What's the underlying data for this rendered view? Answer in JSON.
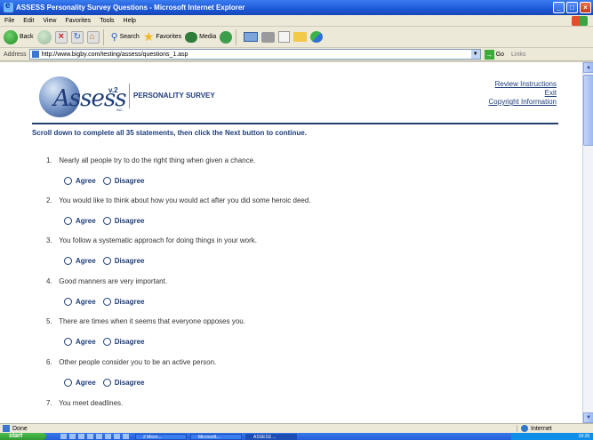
{
  "window": {
    "title": "ASSESS Personality Survey Questions - Microsoft Internet Explorer"
  },
  "menu": [
    "File",
    "Edit",
    "View",
    "Favorites",
    "Tools",
    "Help"
  ],
  "toolbar": {
    "back": "Back",
    "search": "Search",
    "favorites": "Favorites",
    "media": "Media"
  },
  "address": {
    "label": "Address",
    "url": "http://www.bigby.com/testing/assess/questions_1.asp",
    "go": "Go",
    "links": "Links"
  },
  "page": {
    "logo_word": "Assess",
    "logo_version": "v.2",
    "logo_inc": "INC.",
    "survey_title": "PERSONALITY SURVEY",
    "links": [
      "Review Instructions",
      "Exit",
      "Copyright Information"
    ],
    "intro": "Scroll down to complete all 35 statements, then click the Next button to continue.",
    "answer_agree": "Agree",
    "answer_disagree": "Disagree",
    "questions": [
      {
        "num": "1.",
        "text": "Nearly all people try to do the right thing when given a chance."
      },
      {
        "num": "2.",
        "text": "You would like to think about how you would act after you did some heroic deed."
      },
      {
        "num": "3.",
        "text": "You follow a systematic approach for doing things in your work."
      },
      {
        "num": "4.",
        "text": "Good manners are very important."
      },
      {
        "num": "5.",
        "text": "There are times when it seems that everyone opposes you."
      },
      {
        "num": "6.",
        "text": "Other people consider you to be an active person."
      },
      {
        "num": "7.",
        "text": "You meet deadlines."
      }
    ]
  },
  "status": {
    "left": "Done",
    "zone": "Internet"
  },
  "taskbar": {
    "start": "start",
    "tasks": [
      "2 Micro...",
      "Microsoft...",
      "ASSESS ..."
    ],
    "clock": "18:28"
  }
}
